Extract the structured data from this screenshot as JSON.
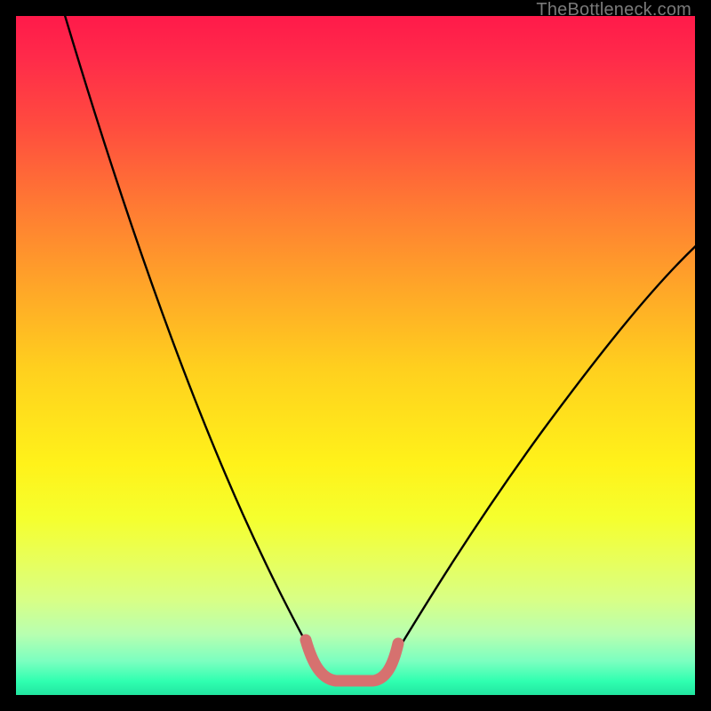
{
  "watermark": "TheBottleneck.com",
  "chart_data": {
    "type": "line",
    "title": "",
    "xlabel": "",
    "ylabel": "",
    "xlim": [
      0,
      100
    ],
    "ylim": [
      0,
      100
    ],
    "background_gradient": {
      "top": "#ff1a4a",
      "middle": "#fff21a",
      "bottom": "#22e5a0"
    },
    "series": [
      {
        "name": "left-curve",
        "color": "#000000",
        "x": [
          8,
          12,
          16,
          20,
          24,
          28,
          32,
          36,
          40,
          43,
          45
        ],
        "y": [
          100,
          86,
          73,
          61,
          50,
          40,
          31,
          23,
          15,
          9,
          4
        ]
      },
      {
        "name": "right-curve",
        "color": "#000000",
        "x": [
          55,
          58,
          62,
          66,
          70,
          74,
          78,
          82,
          86,
          90,
          94,
          98,
          100
        ],
        "y": [
          5,
          9,
          15,
          21,
          27,
          33,
          39,
          45,
          51,
          56,
          61,
          65,
          67
        ]
      },
      {
        "name": "trough-highlight",
        "color": "#d6716f",
        "x": [
          43,
          45,
          47,
          50,
          53,
          55,
          56
        ],
        "y": [
          9,
          4,
          2,
          2,
          2,
          5,
          9
        ]
      }
    ]
  }
}
